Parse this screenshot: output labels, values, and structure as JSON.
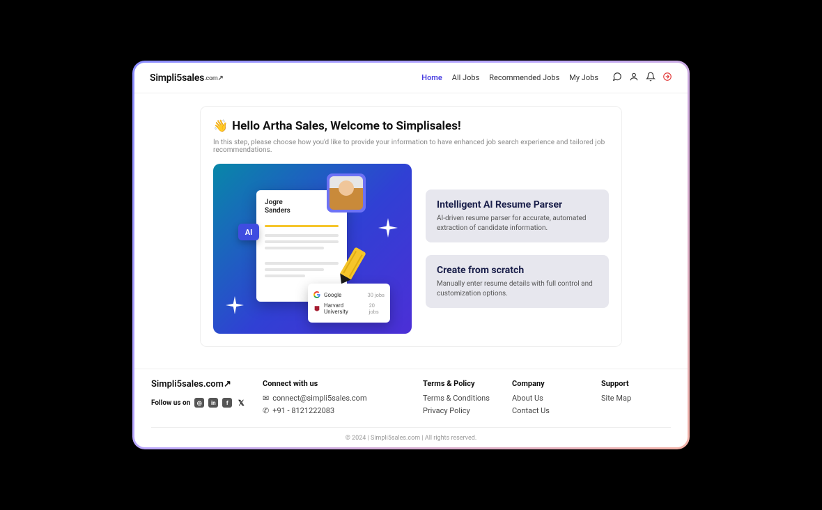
{
  "brand": {
    "name": "Simpli5sales",
    "suffix": ".com",
    "arrow": "↗"
  },
  "nav": {
    "items": [
      {
        "label": "Home",
        "active": true
      },
      {
        "label": "All Jobs",
        "active": false
      },
      {
        "label": "Recommended Jobs",
        "active": false
      },
      {
        "label": "My Jobs",
        "active": false
      }
    ]
  },
  "welcome": {
    "emoji": "👋",
    "title": "Hello Artha Sales, Welcome to Simplisales!",
    "subtext": "In this step, please choose how you'd like to provide your information to have enhanced job search experience and tailored job recommendations."
  },
  "illustration": {
    "name": "Jogre\nSanders",
    "ai_label": "AI",
    "tags": [
      {
        "name": "Google",
        "jobs": "30 jobs"
      },
      {
        "name": "Harvard University",
        "jobs": "20 jobs"
      }
    ]
  },
  "options": [
    {
      "title": "Intelligent AI Resume Parser",
      "desc": "AI-driven resume parser for accurate, automated extraction of candidate information."
    },
    {
      "title": "Create from scratch",
      "desc": "Manually enter resume details with full control and customization options."
    }
  ],
  "footer": {
    "follow_label": "Follow us on",
    "connect": {
      "heading": "Connect with us",
      "email": "connect@simpli5sales.com",
      "phone": "+91 - 8121222083"
    },
    "terms": {
      "heading": "Terms & Policy",
      "links": [
        "Terms & Conditions",
        "Privacy Policy"
      ]
    },
    "company": {
      "heading": "Company",
      "links": [
        "About Us",
        "Contact Us"
      ]
    },
    "support": {
      "heading": "Support",
      "links": [
        "Site Map"
      ]
    },
    "copyright": "© 2024 | Simpli5sales.com | All rights reserved."
  }
}
